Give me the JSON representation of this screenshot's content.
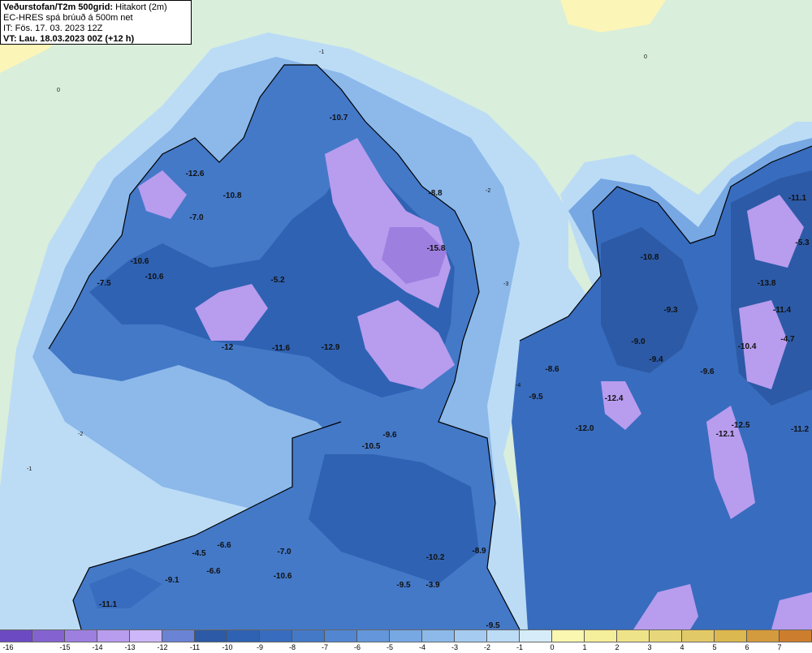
{
  "header": {
    "product_name": "Veðurstofan/T2m 500grid:",
    "product_desc": "Hitakort (2m)",
    "model_line": "EC-HRES spá brúuð á 500m net",
    "initial_time": "IT: Fös. 17. 03. 2023 12Z",
    "valid_time": "VT: Lau. 18.03.2023 00Z (+12 h)"
  },
  "colors": {
    "land_background": "#d9eedb",
    "sea_warm": "#fbf5b8",
    "coastline": "#000000"
  },
  "colorbar": {
    "swatch_colors": [
      "#6c4bc2",
      "#8463d0",
      "#9d7fe0",
      "#b89cee",
      "#cdb7f8",
      "#6a83d4",
      "#2c5aa6",
      "#2f62b2",
      "#386cbe",
      "#4479c8",
      "#5286d1",
      "#6396da",
      "#77a8e3",
      "#8cb9ea",
      "#a5cbf1",
      "#bcdcf6",
      "#d6ecf9",
      "#f9f7b0",
      "#f5ee9a",
      "#efe38a",
      "#e8d77a",
      "#e2c968",
      "#dbb850",
      "#d49a3e",
      "#cc7e2e"
    ],
    "tick_labels": [
      "-16",
      "-15",
      "-14",
      "-13",
      "-12",
      "-11",
      "-10",
      "-9",
      "-8",
      "-7",
      "-6",
      "-5",
      "-4",
      "-3",
      "-2",
      "-1",
      "0",
      "1",
      "2",
      "3",
      "4",
      "5",
      "6",
      "7"
    ]
  },
  "map_icon": "iceland-temperature-map",
  "sea_labels": [
    {
      "text": "0",
      "name": "sea-contour-0-nw"
    },
    {
      "text": "0",
      "name": "sea-contour-0-ne"
    },
    {
      "text": "-1",
      "name": "sea-contour-m1-n"
    },
    {
      "text": "-1",
      "name": "sea-contour-m1-w"
    },
    {
      "text": "-2",
      "name": "sea-contour-m2-w"
    },
    {
      "text": "-2",
      "name": "sea-contour-m2-e"
    },
    {
      "text": "-3",
      "name": "sea-contour-m3"
    },
    {
      "text": "-4",
      "name": "sea-contour-m4"
    }
  ],
  "value_labels": [
    "-12.6",
    "-10.8",
    "-7.0",
    "-10.6",
    "-10.6",
    "-7.5",
    "-10.7",
    "-15.8",
    "-8.8",
    "-5.2",
    "-12",
    "-11.6",
    "-12.9",
    "-10.8",
    "-13.8",
    "-11.1",
    "-5.3",
    "-9.3",
    "-9.0",
    "-9.4",
    "-10.4",
    "-11.4",
    "-4.7",
    "-8.6",
    "-9.5",
    "-12.4",
    "-9.6",
    "-12.0",
    "-10.5",
    "-9.6",
    "-12.5",
    "-12.1",
    "-11.2",
    "-10.2",
    "-8.9",
    "-7.0",
    "-6.6",
    "-6.6",
    "-4.5",
    "-9.1",
    "-10.6",
    "-9.5",
    "-3.9",
    "-11.1",
    "-9.5"
  ]
}
